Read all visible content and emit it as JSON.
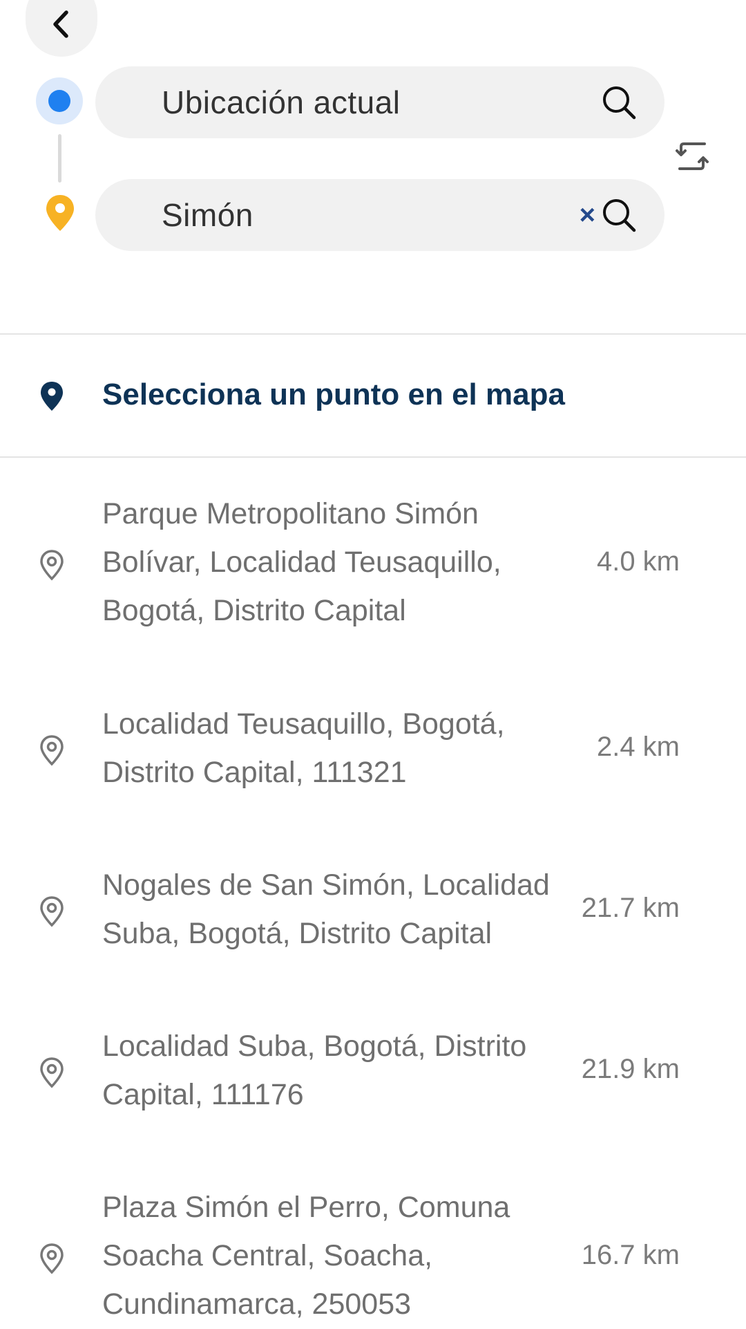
{
  "header": {
    "back_icon": "chevron-left-icon",
    "origin_field": {
      "value": "Ubicación actual",
      "icon": "search-icon"
    },
    "destination_field": {
      "value": "Simón",
      "clear_label": "×",
      "icon": "search-icon"
    },
    "swap_icon": "swap-icon"
  },
  "map_option": {
    "label": "Selecciona un punto en el mapa",
    "icon": "map-pin-filled-icon"
  },
  "results": [
    {
      "lines": [
        "Parque Metropolitano Simón",
        "Bolívar, Localidad Teusaquillo,",
        "Bogotá, Distrito Capital"
      ],
      "distance": "4.0 km"
    },
    {
      "lines": [
        "Localidad Teusaquillo, Bogotá,",
        "Distrito Capital, 111321"
      ],
      "distance": "2.4 km"
    },
    {
      "lines": [
        "Nogales de San Simón, Localidad",
        "Suba, Bogotá, Distrito Capital"
      ],
      "distance": "21.7 km"
    },
    {
      "lines": [
        "Localidad Suba, Bogotá, Distrito",
        "Capital, 111176"
      ],
      "distance": "21.9 km"
    },
    {
      "lines": [
        "Plaza Simón el Perro, Comuna",
        "Soacha Central, Soacha,",
        "Cundinamarca, 250053"
      ],
      "distance": "16.7 km"
    }
  ],
  "colors": {
    "origin_dot": "#1f80f0",
    "destination_pin": "#f7b224",
    "accent_text": "#0e3356"
  }
}
